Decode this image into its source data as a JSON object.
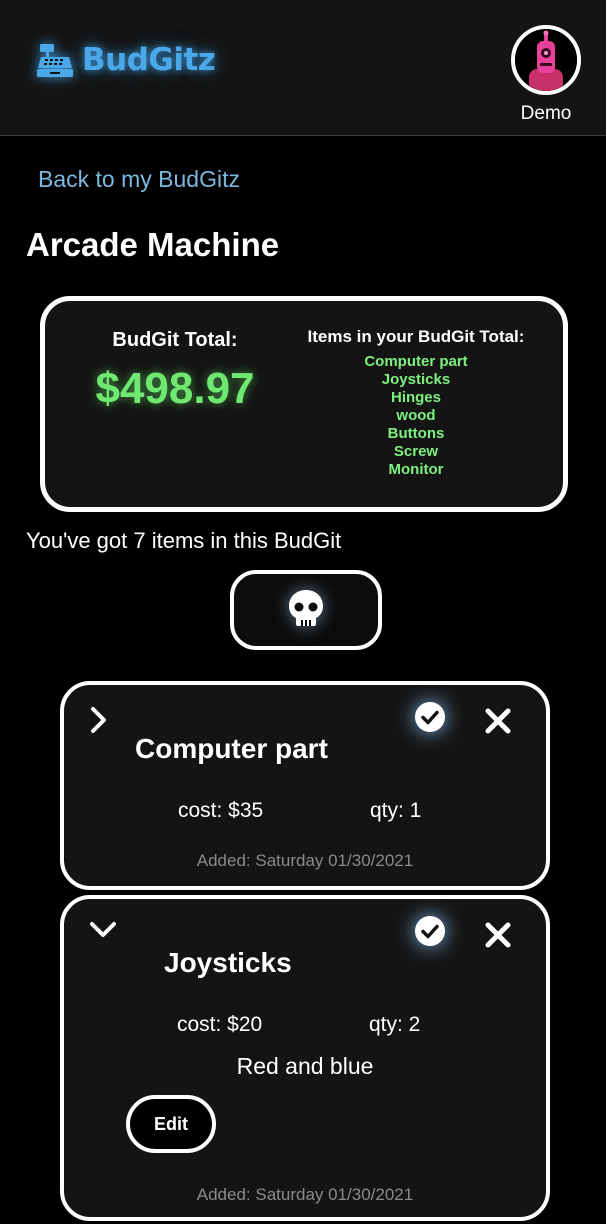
{
  "header": {
    "brand": "BudGitz",
    "logo_icon": "cash-register-icon",
    "user_name": "Demo",
    "avatar_icon": "robot-avatar-icon",
    "brand_color": "#4aa8e8"
  },
  "nav": {
    "back_label": "Back to my BudGitz"
  },
  "budgit": {
    "title": "Arcade Machine",
    "total_label": "BudGit Total:",
    "total_value": "$498.97",
    "items_heading": "Items in your BudGit Total:",
    "items": [
      "Computer part",
      "Joysticks",
      "Hinges",
      "wood",
      "Buttons",
      "Screw",
      "Monitor"
    ],
    "count_text": "You've got 7 items in this BudGit",
    "delete_icon": "skull-icon",
    "accent_green": "#6ee870"
  },
  "item_cards": [
    {
      "name": "Computer part",
      "cost": "cost: $35",
      "qty": "qty: 1",
      "added": "Added: Saturday 01/30/2021",
      "expanded": false
    },
    {
      "name": "Joysticks",
      "cost": "cost: $20",
      "qty": "qty: 2",
      "note": "Red and blue",
      "edit_label": "Edit",
      "added": "Added: Saturday 01/30/2021",
      "expanded": true
    }
  ]
}
